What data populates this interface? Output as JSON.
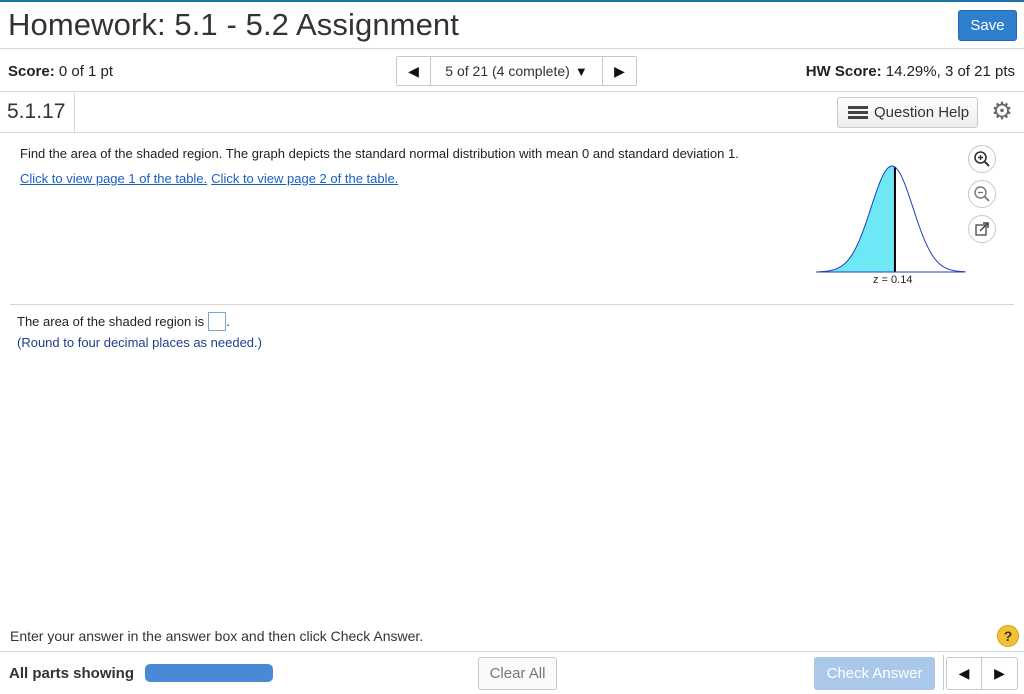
{
  "header": {
    "title": "Homework: 5.1 - 5.2 Assignment",
    "save_label": "Save"
  },
  "score_bar": {
    "score_label": "Score:",
    "score_value": "0 of 1 pt",
    "nav_position": "5 of 21 (4 complete)",
    "hw_score_label": "HW Score:",
    "hw_score_value": "14.29%, 3 of 21 pts"
  },
  "question": {
    "number": "5.1.17",
    "help_label": "Question Help",
    "prompt": "Find the area of the shaded region. The graph depicts the standard normal distribution with mean 0 and standard deviation 1.",
    "links": [
      "Click to view page 1 of the table.",
      "Click to view page 2 of the table."
    ],
    "z_label": "z = 0.14",
    "answer_prefix": "The area of the shaded region is",
    "answer_suffix": ".",
    "answer_value": "",
    "round_note": "(Round to four decimal places as needed.)"
  },
  "graph": {
    "shaded_to_z": 0.14,
    "fill_color": "#6ee8f5",
    "curve_color": "#1f3fbf"
  },
  "footer": {
    "instruction": "Enter your answer in the answer box and then click Check Answer.",
    "parts_label": "All parts showing",
    "progress": 1.0,
    "clear_label": "Clear All",
    "check_label": "Check Answer",
    "help_glyph": "?"
  },
  "icons": {
    "gear": "gear-icon",
    "zoom_in": "zoom-in-icon",
    "zoom_out": "zoom-out-icon",
    "popout": "popout-icon",
    "list": "list-icon"
  },
  "colors": {
    "accent": "#2f7fcf",
    "link": "#1a5fc4",
    "check_disabled": "#a9c8ea"
  }
}
